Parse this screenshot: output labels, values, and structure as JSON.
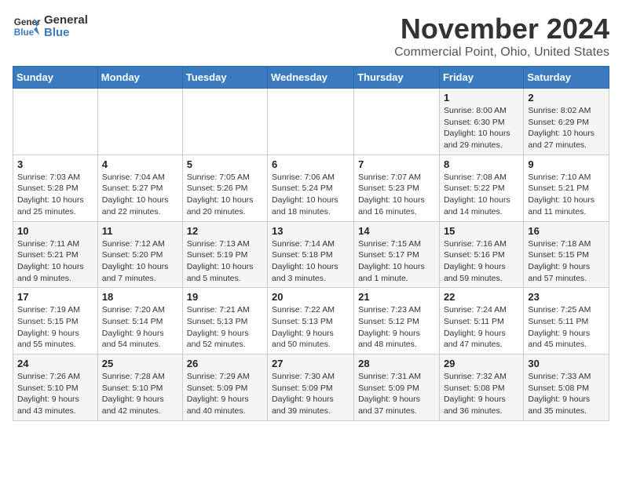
{
  "logo": {
    "line1": "General",
    "line2": "Blue"
  },
  "title": "November 2024",
  "location": "Commercial Point, Ohio, United States",
  "days_of_week": [
    "Sunday",
    "Monday",
    "Tuesday",
    "Wednesday",
    "Thursday",
    "Friday",
    "Saturday"
  ],
  "weeks": [
    [
      {
        "day": "",
        "info": ""
      },
      {
        "day": "",
        "info": ""
      },
      {
        "day": "",
        "info": ""
      },
      {
        "day": "",
        "info": ""
      },
      {
        "day": "",
        "info": ""
      },
      {
        "day": "1",
        "info": "Sunrise: 8:00 AM\nSunset: 6:30 PM\nDaylight: 10 hours\nand 29 minutes."
      },
      {
        "day": "2",
        "info": "Sunrise: 8:02 AM\nSunset: 6:29 PM\nDaylight: 10 hours\nand 27 minutes."
      }
    ],
    [
      {
        "day": "3",
        "info": "Sunrise: 7:03 AM\nSunset: 5:28 PM\nDaylight: 10 hours\nand 25 minutes."
      },
      {
        "day": "4",
        "info": "Sunrise: 7:04 AM\nSunset: 5:27 PM\nDaylight: 10 hours\nand 22 minutes."
      },
      {
        "day": "5",
        "info": "Sunrise: 7:05 AM\nSunset: 5:26 PM\nDaylight: 10 hours\nand 20 minutes."
      },
      {
        "day": "6",
        "info": "Sunrise: 7:06 AM\nSunset: 5:24 PM\nDaylight: 10 hours\nand 18 minutes."
      },
      {
        "day": "7",
        "info": "Sunrise: 7:07 AM\nSunset: 5:23 PM\nDaylight: 10 hours\nand 16 minutes."
      },
      {
        "day": "8",
        "info": "Sunrise: 7:08 AM\nSunset: 5:22 PM\nDaylight: 10 hours\nand 14 minutes."
      },
      {
        "day": "9",
        "info": "Sunrise: 7:10 AM\nSunset: 5:21 PM\nDaylight: 10 hours\nand 11 minutes."
      }
    ],
    [
      {
        "day": "10",
        "info": "Sunrise: 7:11 AM\nSunset: 5:21 PM\nDaylight: 10 hours\nand 9 minutes."
      },
      {
        "day": "11",
        "info": "Sunrise: 7:12 AM\nSunset: 5:20 PM\nDaylight: 10 hours\nand 7 minutes."
      },
      {
        "day": "12",
        "info": "Sunrise: 7:13 AM\nSunset: 5:19 PM\nDaylight: 10 hours\nand 5 minutes."
      },
      {
        "day": "13",
        "info": "Sunrise: 7:14 AM\nSunset: 5:18 PM\nDaylight: 10 hours\nand 3 minutes."
      },
      {
        "day": "14",
        "info": "Sunrise: 7:15 AM\nSunset: 5:17 PM\nDaylight: 10 hours\nand 1 minute."
      },
      {
        "day": "15",
        "info": "Sunrise: 7:16 AM\nSunset: 5:16 PM\nDaylight: 9 hours\nand 59 minutes."
      },
      {
        "day": "16",
        "info": "Sunrise: 7:18 AM\nSunset: 5:15 PM\nDaylight: 9 hours\nand 57 minutes."
      }
    ],
    [
      {
        "day": "17",
        "info": "Sunrise: 7:19 AM\nSunset: 5:15 PM\nDaylight: 9 hours\nand 55 minutes."
      },
      {
        "day": "18",
        "info": "Sunrise: 7:20 AM\nSunset: 5:14 PM\nDaylight: 9 hours\nand 54 minutes."
      },
      {
        "day": "19",
        "info": "Sunrise: 7:21 AM\nSunset: 5:13 PM\nDaylight: 9 hours\nand 52 minutes."
      },
      {
        "day": "20",
        "info": "Sunrise: 7:22 AM\nSunset: 5:13 PM\nDaylight: 9 hours\nand 50 minutes."
      },
      {
        "day": "21",
        "info": "Sunrise: 7:23 AM\nSunset: 5:12 PM\nDaylight: 9 hours\nand 48 minutes."
      },
      {
        "day": "22",
        "info": "Sunrise: 7:24 AM\nSunset: 5:11 PM\nDaylight: 9 hours\nand 47 minutes."
      },
      {
        "day": "23",
        "info": "Sunrise: 7:25 AM\nSunset: 5:11 PM\nDaylight: 9 hours\nand 45 minutes."
      }
    ],
    [
      {
        "day": "24",
        "info": "Sunrise: 7:26 AM\nSunset: 5:10 PM\nDaylight: 9 hours\nand 43 minutes."
      },
      {
        "day": "25",
        "info": "Sunrise: 7:28 AM\nSunset: 5:10 PM\nDaylight: 9 hours\nand 42 minutes."
      },
      {
        "day": "26",
        "info": "Sunrise: 7:29 AM\nSunset: 5:09 PM\nDaylight: 9 hours\nand 40 minutes."
      },
      {
        "day": "27",
        "info": "Sunrise: 7:30 AM\nSunset: 5:09 PM\nDaylight: 9 hours\nand 39 minutes."
      },
      {
        "day": "28",
        "info": "Sunrise: 7:31 AM\nSunset: 5:09 PM\nDaylight: 9 hours\nand 37 minutes."
      },
      {
        "day": "29",
        "info": "Sunrise: 7:32 AM\nSunset: 5:08 PM\nDaylight: 9 hours\nand 36 minutes."
      },
      {
        "day": "30",
        "info": "Sunrise: 7:33 AM\nSunset: 5:08 PM\nDaylight: 9 hours\nand 35 minutes."
      }
    ]
  ]
}
